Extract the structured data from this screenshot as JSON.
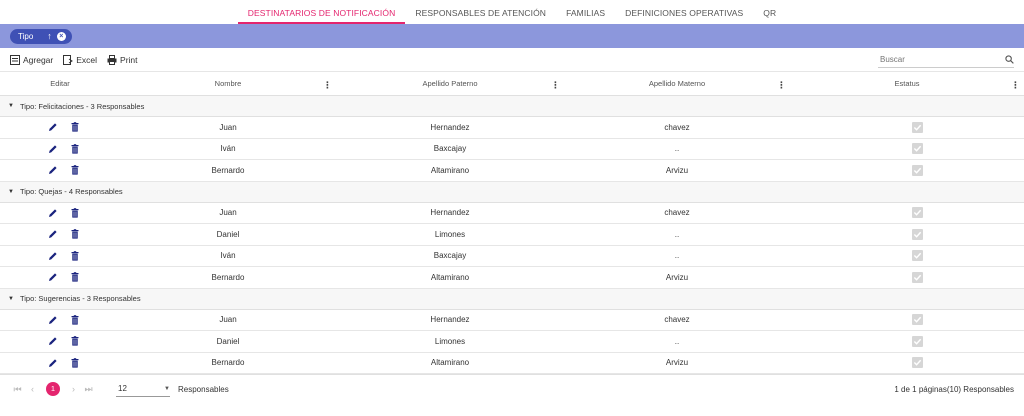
{
  "tabs": [
    {
      "label": "DESTINATARIOS DE NOTIFICACIÓN",
      "active": true
    },
    {
      "label": "RESPONSABLES DE ATENCIÓN",
      "active": false
    },
    {
      "label": "FAMILIAS",
      "active": false
    },
    {
      "label": "DEFINICIONES OPERATIVAS",
      "active": false
    },
    {
      "label": "QR",
      "active": false
    }
  ],
  "group_chip": {
    "label": "Tipo"
  },
  "toolbar": {
    "add_label": "Agregar",
    "excel_label": "Excel",
    "print_label": "Print",
    "search_placeholder": "Buscar"
  },
  "columns": {
    "edit": "Editar",
    "nombre": "Nombre",
    "paterno": "Apellido Paterno",
    "materno": "Apellido Materno",
    "estatus": "Estatus"
  },
  "groups": [
    {
      "label": "Tipo: Felicitaciones - 3 Responsables",
      "rows": [
        {
          "nombre": "Juan",
          "paterno": "Hernandez",
          "materno": "chavez",
          "estatus": true
        },
        {
          "nombre": "Iván",
          "paterno": "Baxcajay",
          "materno": "..",
          "estatus": true
        },
        {
          "nombre": "Bernardo",
          "paterno": "Altamirano",
          "materno": "Arvizu",
          "estatus": true
        }
      ]
    },
    {
      "label": "Tipo: Quejas - 4 Responsables",
      "rows": [
        {
          "nombre": "Juan",
          "paterno": "Hernandez",
          "materno": "chavez",
          "estatus": true
        },
        {
          "nombre": "Daniel",
          "paterno": "Limones",
          "materno": "..",
          "estatus": true
        },
        {
          "nombre": "Iván",
          "paterno": "Baxcajay",
          "materno": "..",
          "estatus": true
        },
        {
          "nombre": "Bernardo",
          "paterno": "Altamirano",
          "materno": "Arvizu",
          "estatus": true
        }
      ]
    },
    {
      "label": "Tipo: Sugerencias - 3 Responsables",
      "rows": [
        {
          "nombre": "Juan",
          "paterno": "Hernandez",
          "materno": "chavez",
          "estatus": true
        },
        {
          "nombre": "Daniel",
          "paterno": "Limones",
          "materno": "..",
          "estatus": true
        },
        {
          "nombre": "Bernardo",
          "paterno": "Altamirano",
          "materno": "Arvizu",
          "estatus": true
        }
      ]
    }
  ],
  "pager": {
    "current_page": "1",
    "page_size": "12",
    "items_label": "Responsables",
    "info": "1 de 1 páginas(10) Responsables"
  },
  "colors": {
    "accent": "#e4256e",
    "group_bar": "#8c97dc",
    "chip": "#3f51b5"
  },
  "icons": {
    "edit": "pencil-icon",
    "delete": "trash-icon",
    "add": "add-record-icon",
    "excel": "excel-export-icon",
    "print": "print-icon",
    "search": "search-icon",
    "status": "checkbox-checked-icon"
  }
}
